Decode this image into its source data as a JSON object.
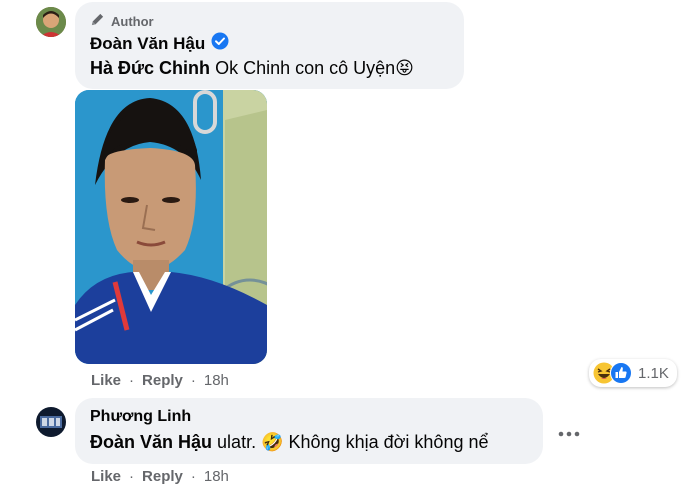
{
  "comment1": {
    "badge": "Author",
    "author_name": "Đoàn Văn Hậu",
    "mention": "Hà Đức Chinh",
    "text": "Ok Chinh con cô Uyện",
    "emoji": "😝",
    "actions": {
      "like": "Like",
      "reply": "Reply",
      "time": "18h"
    },
    "reactions_count": "1.1K"
  },
  "comment2": {
    "author_name": "Phương Linh",
    "mention": "Đoàn Văn Hậu",
    "text": "ulatr.",
    "emoji": "🤣",
    "text2": "Không khịa đời không nể",
    "actions": {
      "like": "Like",
      "reply": "Reply",
      "time": "18h"
    }
  },
  "icons": {
    "author_badge": "pencil-icon",
    "verified": "verified-badge-icon",
    "reaction_1": "haha-reaction-icon",
    "reaction_2": "like-reaction-icon",
    "more": "more-options-icon"
  },
  "colors": {
    "bubble": "#f0f2f5",
    "verified": "#1877f2",
    "secondary_text": "#65676b"
  }
}
